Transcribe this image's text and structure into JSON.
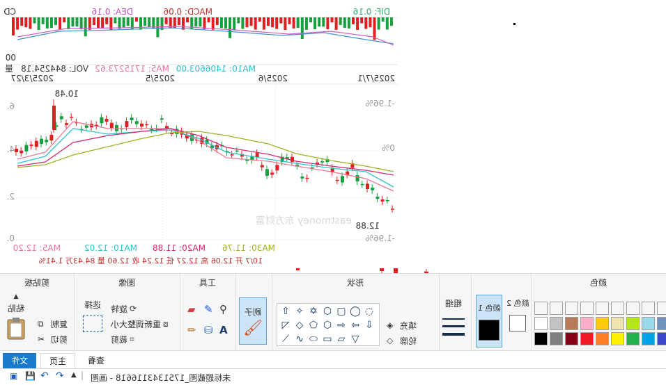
{
  "window": {
    "title": "未标题截图_1751343116618 - 画图",
    "quick_access": [
      "save-icon",
      "undo-icon",
      "redo-icon",
      "dropdown-icon"
    ]
  },
  "tabs": [
    {
      "label": "文件"
    },
    {
      "label": "主页"
    },
    {
      "label": "查看"
    }
  ],
  "ribbon": {
    "clipboard": {
      "title": "剪贴板",
      "paste": "粘贴",
      "cut": "剪切",
      "copy": "复制"
    },
    "image": {
      "title": "图像",
      "select": "选择",
      "crop": "裁剪",
      "resize": "重新调整大小",
      "rotate": "旋转"
    },
    "tools": {
      "title": "工具"
    },
    "brushes": {
      "label": "刷子"
    },
    "shapes": {
      "title": "形状",
      "outline": "轮廓",
      "fill": "填充"
    },
    "size": {
      "label": "粗细"
    },
    "color1": {
      "label": "颜色 1"
    },
    "color2": {
      "label": "颜色 2"
    },
    "colors": {
      "title": "颜色",
      "palette_row1": [
        "#000000",
        "#7f7f7f",
        "#880015",
        "#ed1c24",
        "#ff7f27",
        "#fff200",
        "#22b14c",
        "#00a2e8",
        "#3f48cc",
        "#a349a4"
      ],
      "palette_row2": [
        "#ffffff",
        "#c3c3c3",
        "#b97a57",
        "#ffaec9",
        "#ffc90e",
        "#efe4b0",
        "#b5e61d",
        "#99d9ea",
        "#7092be",
        "#c8bfe7"
      ],
      "color1_value": "#000000",
      "color2_value": "#ffffff"
    }
  },
  "chart": {
    "macd_header": {
      "macd": "MACD: 0.06",
      "dea": "DEA: 0.16",
      "dif": "DIF: 0.16",
      "prefix": "CD"
    },
    "vol_header": {
      "vol": "VOL: 844254.18",
      "ma5": "MA5: 1715273.62",
      "ma10": "MA10: 1406603.00",
      "prefix": "量"
    },
    "dates": [
      "2025/3/27",
      "2025/5",
      "2025/6",
      "2025/7/1"
    ],
    "price_labels": {
      "high": "10.48",
      "low": "12.88"
    },
    "left_axis": [
      "6.",
      "4.",
      "2.",
      "0."
    ],
    "right_axis": [
      "-1.96%",
      "0%",
      "-1.96%"
    ],
    "ma_legend": {
      "ma5": "MA5: 12.20",
      "ma10": "MA10: 12.02",
      "ma20": "MA20: 11.88",
      "ma30": "MA30: 11.76"
    },
    "info_line": "10/7 开 12.06 高 12.27 低 12.24 收 12.60 量 84.43万 1.41%",
    "watermark": "eastmoney 东方财富",
    "colors": {
      "up": "#e02020",
      "down": "#18a040",
      "ma5": "#e87898",
      "ma10": "#30c0d0",
      "ma20": "#d02870",
      "ma30": "#a0b020"
    },
    "chart_data": {
      "type": "candlestick",
      "title": "",
      "series": [
        {
          "name": "MA5",
          "values": [
            12.2
          ]
        },
        {
          "name": "MA10",
          "values": [
            12.02
          ]
        },
        {
          "name": "MA20",
          "values": [
            11.88
          ]
        },
        {
          "name": "MA30",
          "values": [
            11.76
          ]
        }
      ]
    }
  }
}
